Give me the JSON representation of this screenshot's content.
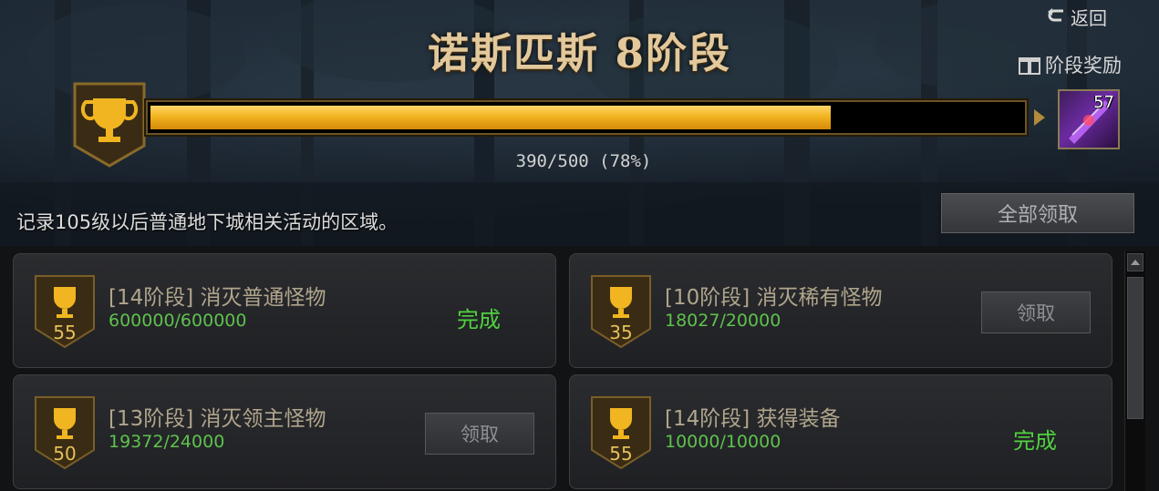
{
  "header": {
    "back_label": "返回",
    "title": "诺斯匹斯 8阶段",
    "stage_reward_label": "阶段奖励",
    "progress": {
      "current": 390,
      "total": 500,
      "percent": 78,
      "text": "390/500 (78%)"
    },
    "reward_item": {
      "count": "57",
      "icon": "purple-weapon-icon"
    },
    "description": "记录105级以后普通地下城相关活动的区域。",
    "claim_all_label": "全部领取"
  },
  "quests": [
    {
      "badge_value": "55",
      "name": "[14阶段] 消灭普通怪物",
      "progress": "600000/600000",
      "status": "complete",
      "status_label": "完成"
    },
    {
      "badge_value": "35",
      "name": "[10阶段] 消灭稀有怪物",
      "progress": "18027/20000",
      "status": "claim",
      "status_label": "领取"
    },
    {
      "badge_value": "50",
      "name": "[13阶段] 消灭领主怪物",
      "progress": "19372/24000",
      "status": "claim",
      "status_label": "领取"
    },
    {
      "badge_value": "55",
      "name": "[14阶段] 获得装备",
      "progress": "10000/10000",
      "status": "complete",
      "status_label": "完成"
    }
  ],
  "colors": {
    "gold": "#f2b420",
    "title": "#e2c89b",
    "complete": "#4fd23f",
    "progress_text": "#5ec24e"
  }
}
